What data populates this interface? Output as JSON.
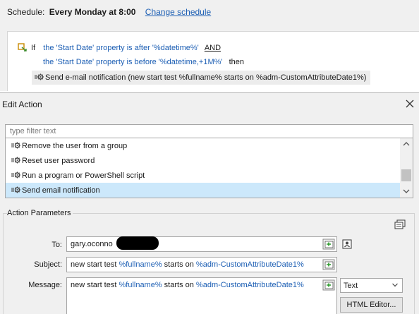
{
  "schedule": {
    "label": "Schedule:",
    "value": "Every Monday at 8:00",
    "change_link": "Change schedule"
  },
  "rule": {
    "if_label": "If",
    "condition1": "the 'Start Date' property is after '%datetime%'",
    "and_label": "AND",
    "condition2": "the 'Start Date' property is before '%datetime,+1M%'",
    "then_label": "then",
    "action": "Send e-mail notification (new start test %fullname% starts on %adm-CustomAttributeDate1%)"
  },
  "dialog": {
    "title": "Edit Action",
    "filter_placeholder": "type filter text",
    "actions": [
      {
        "label": "Remove the user from a group",
        "icon": "gear-icon"
      },
      {
        "label": "Reset user password",
        "icon": "gear-icon"
      },
      {
        "label": "Run a program or PowerShell script",
        "icon": "gear-icon"
      },
      {
        "label": "Send email notification",
        "icon": "gear-icon",
        "selected": true
      }
    ],
    "params": {
      "group_title": "Action Parameters",
      "to_label": "To:",
      "to_value": "gary.oconno",
      "subject_label": "Subject:",
      "subject_parts": [
        "new start test ",
        "%fullname%",
        " starts on ",
        "%adm-CustomAttributeDate1%"
      ],
      "message_label": "Message:",
      "message_parts": [
        "new start test ",
        "%fullname%",
        " starts on ",
        "%adm-CustomAttributeDate1%"
      ],
      "format_selected": "Text",
      "html_editor_label": "HTML Editor..."
    }
  },
  "colors": {
    "accent_blue": "#1d5fb4",
    "selection": "#cce8fb",
    "dialog_bg": "#f0f0f0"
  }
}
